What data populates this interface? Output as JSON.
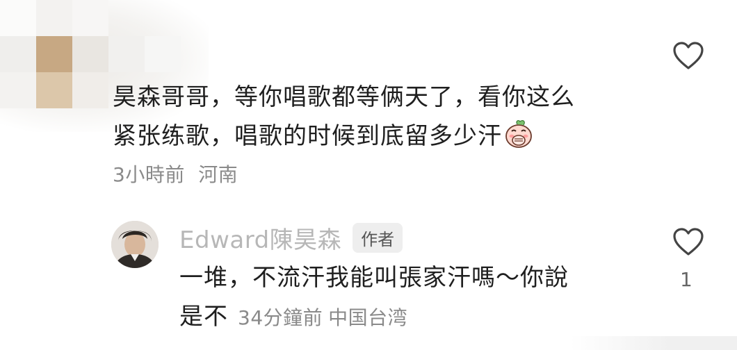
{
  "comment": {
    "text_line1": "昊森哥哥，等你唱歌都等俩天了，看你这么",
    "text_line2": "紧张练歌，唱歌的时候到底留多少汗",
    "emoji": "peach-covering-mouth-emoji",
    "time": "3小時前",
    "location": "河南",
    "like_icon": "heart-outline-icon"
  },
  "reply": {
    "author_name": "Edward陳昊森",
    "author_badge": "作者",
    "text_line1": "一堆，不流汗我能叫張家汗嗎～你說",
    "text_line2": "是不",
    "time": "34分鐘前",
    "location": "中国台湾",
    "like_icon": "heart-outline-icon",
    "like_count": "1"
  },
  "colors": {
    "text": "#1f1f1f",
    "meta": "#8a8a8a",
    "author_name": "#b7b7b7",
    "badge_bg": "#eeeeee",
    "icon": "#444444"
  }
}
